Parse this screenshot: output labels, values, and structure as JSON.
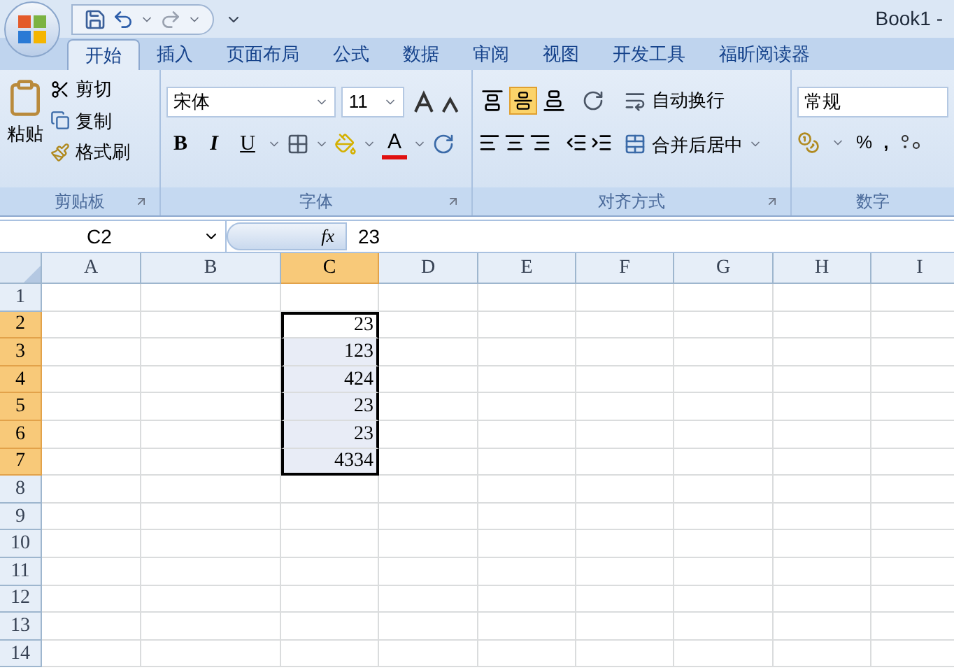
{
  "window": {
    "title": "Book1 -"
  },
  "tabs": [
    {
      "label": "开始",
      "selected": true
    },
    {
      "label": "插入",
      "selected": false
    },
    {
      "label": "页面布局",
      "selected": false
    },
    {
      "label": "公式",
      "selected": false
    },
    {
      "label": "数据",
      "selected": false
    },
    {
      "label": "审阅",
      "selected": false
    },
    {
      "label": "视图",
      "selected": false
    },
    {
      "label": "开发工具",
      "selected": false
    },
    {
      "label": "福昕阅读器",
      "selected": false
    }
  ],
  "clipboard": {
    "paste": "粘贴",
    "cut": "剪切",
    "copy": "复制",
    "format_painter": "格式刷",
    "label": "剪贴板"
  },
  "font": {
    "name": "宋体",
    "size": "11",
    "bold": "B",
    "italic": "I",
    "underline": "U",
    "font_color": "A",
    "label": "字体"
  },
  "alignment": {
    "vertical": [
      {
        "kind": "top",
        "selected": false
      },
      {
        "kind": "middle",
        "selected": true
      },
      {
        "kind": "bottom",
        "selected": false
      }
    ],
    "wrap": "自动换行",
    "merge": "合并后居中",
    "label": "对齐方式"
  },
  "number": {
    "format": "常规",
    "percent": "%",
    "comma": ",",
    "label": "数字"
  },
  "formula_bar": {
    "name_box": "C2",
    "fx": "fx",
    "value": "23"
  },
  "columns": [
    {
      "label": "A",
      "selected": false
    },
    {
      "label": "B",
      "selected": false
    },
    {
      "label": "C",
      "selected": true
    },
    {
      "label": "D",
      "selected": false
    },
    {
      "label": "E",
      "selected": false
    },
    {
      "label": "F",
      "selected": false
    },
    {
      "label": "G",
      "selected": false
    },
    {
      "label": "H",
      "selected": false
    },
    {
      "label": "I",
      "selected": false
    }
  ],
  "rows": [
    {
      "label": "1",
      "selected": false,
      "active": false,
      "cells": [
        null,
        null,
        null,
        null,
        null,
        null,
        null,
        null,
        null
      ]
    },
    {
      "label": "2",
      "selected": true,
      "active": true,
      "cells": [
        null,
        null,
        "23",
        null,
        null,
        null,
        null,
        null,
        null
      ]
    },
    {
      "label": "3",
      "selected": true,
      "active": false,
      "cells": [
        null,
        null,
        "123",
        null,
        null,
        null,
        null,
        null,
        null
      ]
    },
    {
      "label": "4",
      "selected": true,
      "active": false,
      "cells": [
        null,
        null,
        "424",
        null,
        null,
        null,
        null,
        null,
        null
      ]
    },
    {
      "label": "5",
      "selected": true,
      "active": false,
      "cells": [
        null,
        null,
        "23",
        null,
        null,
        null,
        null,
        null,
        null
      ]
    },
    {
      "label": "6",
      "selected": true,
      "active": false,
      "cells": [
        null,
        null,
        "23",
        null,
        null,
        null,
        null,
        null,
        null
      ]
    },
    {
      "label": "7",
      "selected": true,
      "active": false,
      "cells": [
        null,
        null,
        "4334",
        null,
        null,
        null,
        null,
        null,
        null
      ]
    },
    {
      "label": "8",
      "selected": false,
      "active": false,
      "cells": [
        null,
        null,
        null,
        null,
        null,
        null,
        null,
        null,
        null
      ]
    },
    {
      "label": "9",
      "selected": false,
      "active": false,
      "cells": [
        null,
        null,
        null,
        null,
        null,
        null,
        null,
        null,
        null
      ]
    },
    {
      "label": "10",
      "selected": false,
      "active": false,
      "cells": [
        null,
        null,
        null,
        null,
        null,
        null,
        null,
        null,
        null
      ]
    },
    {
      "label": "11",
      "selected": false,
      "active": false,
      "cells": [
        null,
        null,
        null,
        null,
        null,
        null,
        null,
        null,
        null
      ]
    },
    {
      "label": "12",
      "selected": false,
      "active": false,
      "cells": [
        null,
        null,
        null,
        null,
        null,
        null,
        null,
        null,
        null
      ]
    },
    {
      "label": "13",
      "selected": false,
      "active": false,
      "cells": [
        null,
        null,
        null,
        null,
        null,
        null,
        null,
        null,
        null
      ]
    },
    {
      "label": "14",
      "selected": false,
      "active": false,
      "cells": [
        null,
        null,
        null,
        null,
        null,
        null,
        null,
        null,
        null
      ]
    }
  ]
}
